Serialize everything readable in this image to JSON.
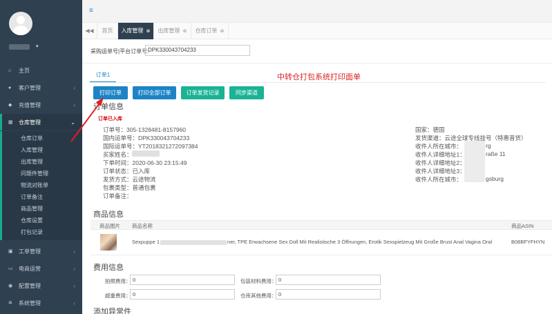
{
  "sidebar": {
    "menu": [
      {
        "label": "主页",
        "icon": "home-icon",
        "glyph": "⌂",
        "arrow": ""
      },
      {
        "label": "客户管理",
        "icon": "user-icon",
        "glyph": "●",
        "arrow": "‹"
      },
      {
        "label": "充值管理",
        "icon": "diamond-icon",
        "glyph": "◆",
        "arrow": "‹"
      },
      {
        "label": "仓库管理",
        "icon": "warehouse-icon",
        "glyph": "▦",
        "arrow": "⌄"
      },
      {
        "label": "工单管理",
        "icon": "ticket-icon",
        "glyph": "▣",
        "arrow": "‹"
      },
      {
        "label": "电商运营",
        "icon": "monitor-icon",
        "glyph": "▭",
        "arrow": "‹"
      },
      {
        "label": "配置管理",
        "icon": "settings-icon",
        "glyph": "◉",
        "arrow": "‹"
      },
      {
        "label": "系统管理",
        "icon": "gear-icon",
        "glyph": "✲",
        "arrow": "‹"
      }
    ],
    "submenu": [
      "仓库订单",
      "入库管理",
      "出库管理",
      "问题件管理",
      "物流对账单",
      "订单备注",
      "商品管理",
      "仓库设置",
      "打包记录"
    ]
  },
  "tabs": {
    "back": "◀◀",
    "items": [
      "首页",
      "入库管理",
      "出库管理",
      "仓库订单"
    ],
    "close": "⊗"
  },
  "search": {
    "label": "采购运单号|平台订单号:",
    "value": "DPK330043704233"
  },
  "order_tab": "订单1",
  "annotation": "中转仓打包系统打印面单",
  "buttons": {
    "print_order": "打印订单",
    "print_all": "打印全部订单",
    "shipping_records": "订单发货记录",
    "sync_channel": "同步渠道"
  },
  "order_info": {
    "title": "订单信息",
    "status_badge": "订单已入库",
    "left": [
      "订单号：305-1328481-8157960",
      "国内运单号：DPK330043704233",
      "国际运单号：YT2018321272097384",
      "买家姓名：",
      "下单时间：2020-06-30 23:15:49",
      "订单状态：已入库",
      "发货方式：云途物流",
      "包裹类型：普通包裹",
      "订单备注："
    ],
    "right": [
      "国家：德国",
      "发货渠道：云途全球专线挂号（特惠普货）",
      "收件人所在城市：",
      "收件人详细地址1：",
      "收件人详细地址2：",
      "收件人详细地址3：",
      "收件人所在城市："
    ],
    "right_tails": [
      "rg",
      "raße 11",
      "gsburg"
    ]
  },
  "products": {
    "title": "商品信息",
    "headers": [
      "商品图片",
      "商品名称",
      "商品ASIN"
    ],
    "rows": [
      {
        "name_prefix": "Sexpuppe 1",
        "name": "ner, TPE Erwachsene Sex Doll Mit Realistische 3 Öffnungen, Erotik Sexspielzeug Mit Große Brust Anal Vagina Oral",
        "asin": "B08BFYFHYN"
      }
    ]
  },
  "fees": {
    "title": "费用信息",
    "items": [
      {
        "label": "拍照费用：",
        "value": "0"
      },
      {
        "label": "包装材料费用：",
        "value": "0"
      },
      {
        "label": "超重费用：",
        "value": "0"
      },
      {
        "label": "仓库其他费用：",
        "value": "0"
      }
    ]
  },
  "attachments_title": "添加异常件"
}
